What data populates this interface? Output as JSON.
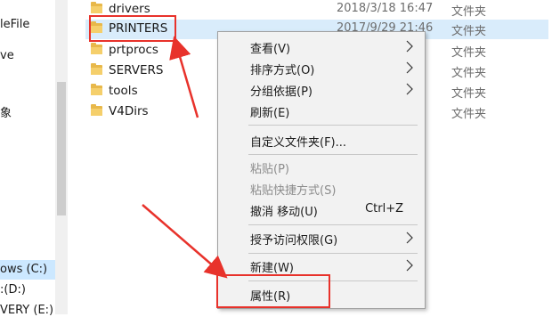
{
  "nav": {
    "items": [
      {
        "label": "leFile",
        "top": 0
      },
      {
        "label": "ve",
        "top": 0
      },
      {
        "label": "象",
        "top": 0
      },
      {
        "label": "ows (C:)",
        "top": 0
      },
      {
        "label": ":(D:)",
        "top": 0
      },
      {
        "label": "VERY (E:)",
        "top": 0
      }
    ]
  },
  "files": [
    {
      "name": "drivers",
      "date": "2018/3/18 16:47",
      "type": "文件夹"
    },
    {
      "name": "PRINTERS",
      "date": "2017/9/29 21:46",
      "type": "文件夹"
    },
    {
      "name": "prtprocs",
      "date": "",
      "type": "文件夹"
    },
    {
      "name": "SERVERS",
      "date": "",
      "type": "文件夹"
    },
    {
      "name": "tools",
      "date": "",
      "type": "文件夹"
    },
    {
      "name": "V4Dirs",
      "date": "",
      "type": "文件夹"
    }
  ],
  "context_menu": {
    "view": "查看(V)",
    "sort": "排序方式(O)",
    "group": "分组依据(P)",
    "refresh": "刷新(E)",
    "customize": "自定义文件夹(F)...",
    "paste": "粘贴(P)",
    "paste_shortcut": "粘贴快捷方式(S)",
    "undo": "撤消 移动(U)",
    "undo_shortcut": "Ctrl+Z",
    "grant_access": "授予访问权限(G)",
    "new": "新建(W)",
    "properties": "属性(R)"
  },
  "colors": {
    "annotation": "#e8322b",
    "folder": "#e8b84a",
    "selection": "#cce8ff"
  }
}
